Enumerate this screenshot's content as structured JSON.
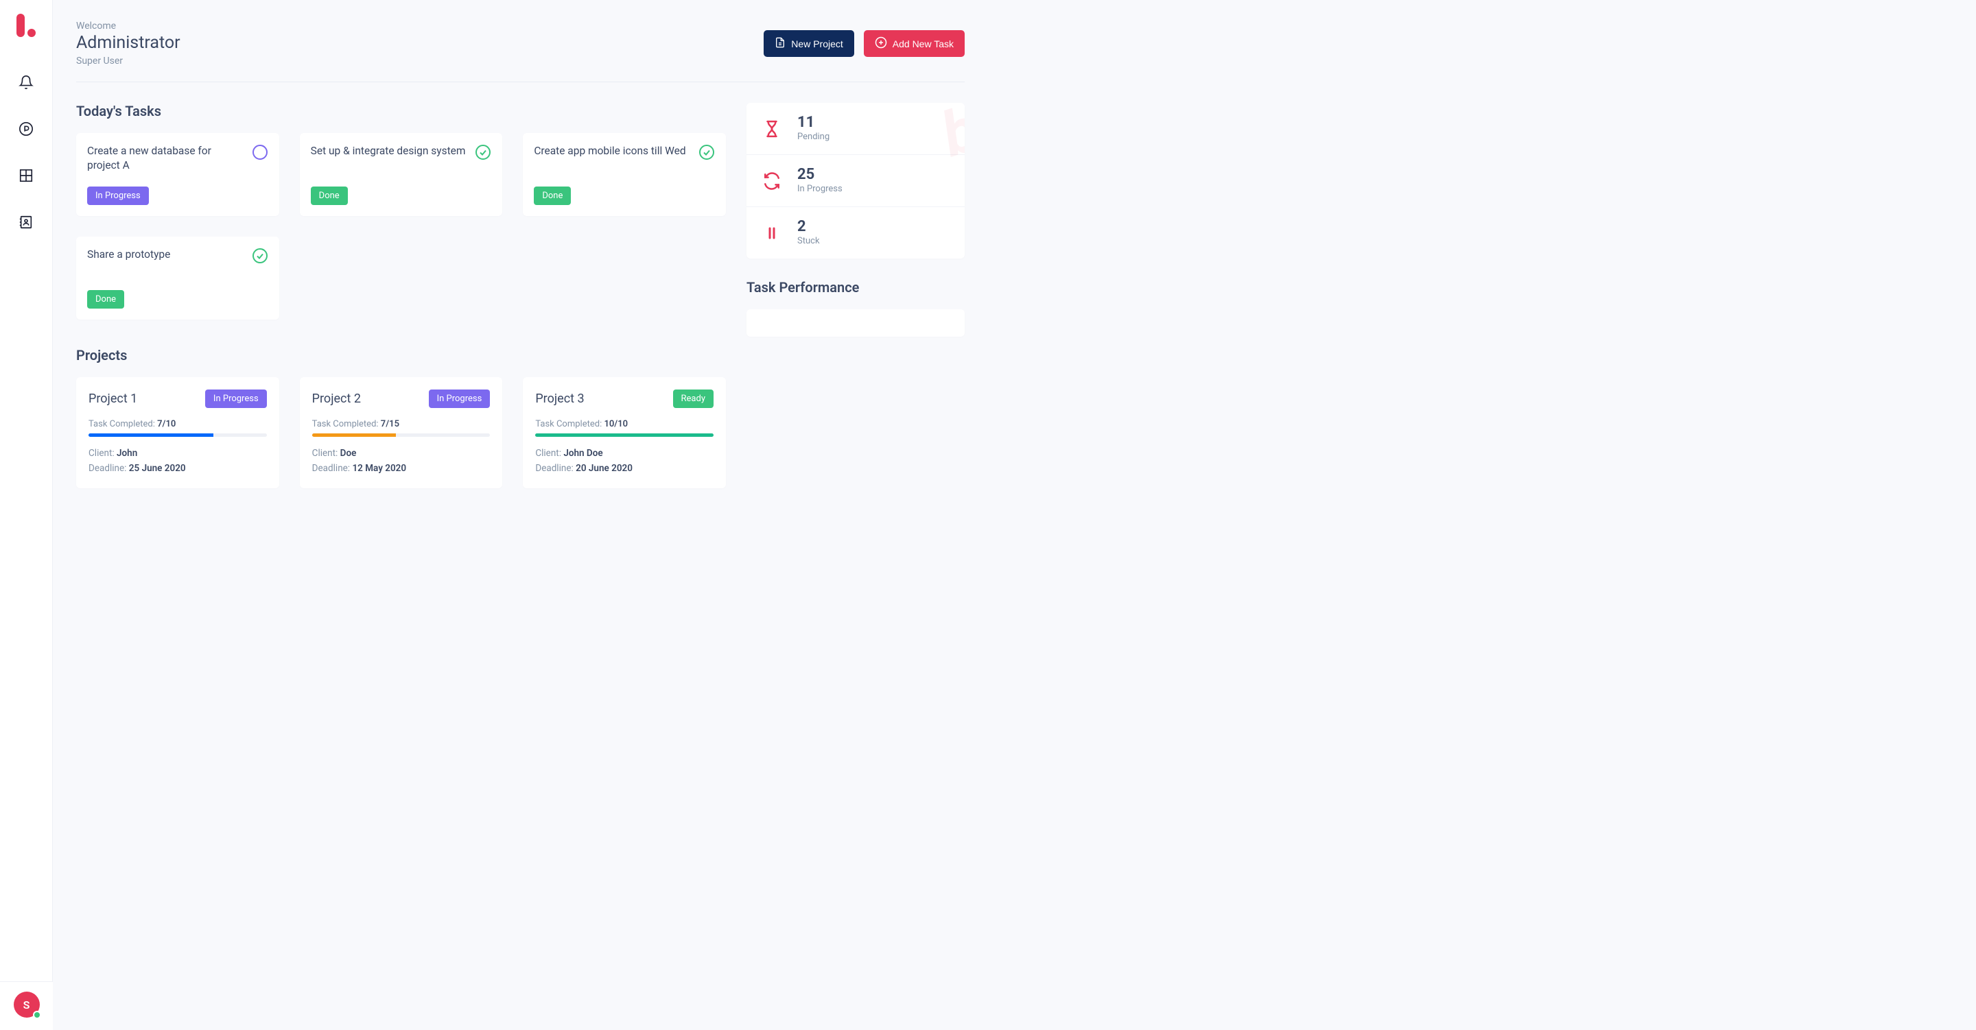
{
  "header": {
    "welcome": "Welcome",
    "title": "Administrator",
    "subtitle": "Super User",
    "new_project_label": "New Project",
    "add_task_label": "Add New Task"
  },
  "sections": {
    "tasks_title": "Today's Tasks",
    "projects_title": "Projects",
    "performance_title": "Task Performance"
  },
  "tasks": [
    {
      "title": "Create a new database for project A",
      "status": "In Progress",
      "status_type": "progress"
    },
    {
      "title": "Set up & integrate design system",
      "status": "Done",
      "status_type": "done"
    },
    {
      "title": "Create app mobile icons till Wed",
      "status": "Done",
      "status_type": "done"
    },
    {
      "title": "Share a prototype",
      "status": "Done",
      "status_type": "done"
    }
  ],
  "projects": [
    {
      "name": "Project 1",
      "status": "In Progress",
      "status_type": "progress",
      "completed": "7/10",
      "percent": 70,
      "color": "#0168fa",
      "client": "John",
      "deadline": "25 June 2020"
    },
    {
      "name": "Project 2",
      "status": "In Progress",
      "status_type": "progress",
      "completed": "7/15",
      "percent": 47,
      "color": "#f49917",
      "client": "Doe",
      "deadline": "12 May 2020"
    },
    {
      "name": "Project 3",
      "status": "Ready",
      "status_type": "done",
      "completed": "10/10",
      "percent": 100,
      "color": "#1cbb8c",
      "client": "John Doe",
      "deadline": "20 June 2020"
    }
  ],
  "stats": [
    {
      "value": "11",
      "label": "Pending",
      "icon": "hourglass"
    },
    {
      "value": "25",
      "label": "In Progress",
      "icon": "refresh"
    },
    {
      "value": "2",
      "label": "Stuck",
      "icon": "pause"
    }
  ],
  "labels": {
    "task_completed": "Task Completed:",
    "client": "Client:",
    "deadline": "Deadline:"
  },
  "avatar": {
    "initial": "S"
  }
}
